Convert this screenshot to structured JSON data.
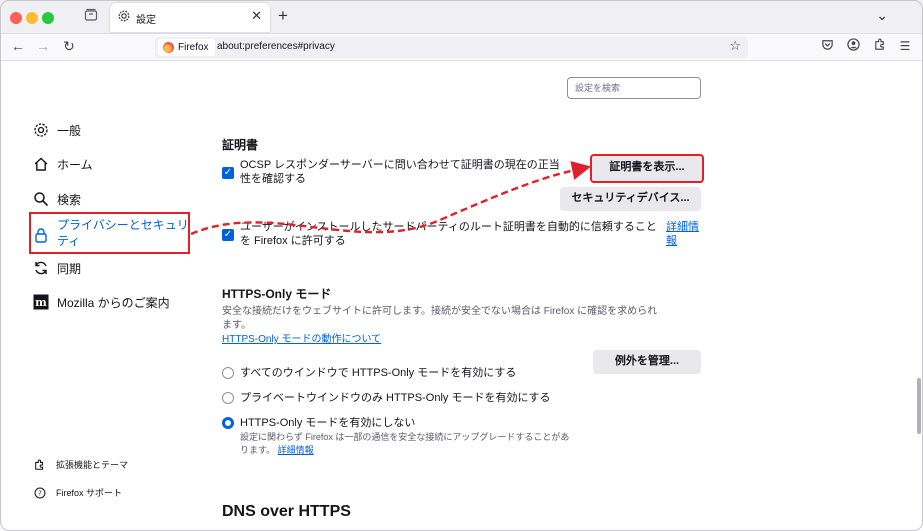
{
  "browser": {
    "tab_title": "設定",
    "identity_label": "Firefox",
    "url": "about:preferences#privacy"
  },
  "search": {
    "placeholder": "設定を検索"
  },
  "sidebar": {
    "items": [
      {
        "label": "一般",
        "icon": "gear-icon"
      },
      {
        "label": "ホーム",
        "icon": "home-icon"
      },
      {
        "label": "検索",
        "icon": "search-icon"
      },
      {
        "label_line1": "プライバシーとセキュリ",
        "label_line2": "ティ",
        "icon": "lock-icon",
        "selected": true
      },
      {
        "label": "同期",
        "icon": "sync-icon"
      },
      {
        "label": "Mozilla からのご案内",
        "icon": "mozilla-icon"
      }
    ],
    "bottom": [
      {
        "label": "拡張機能とテーマ",
        "icon": "puzzle-icon"
      },
      {
        "label": "Firefox サポート",
        "icon": "help-icon"
      }
    ]
  },
  "certificates": {
    "heading": "証明書",
    "ocsp_line1": "OCSP レスポンダーサーバーに問い合わせて証明書の現在の正当",
    "ocsp_line2": "性を確認する",
    "view_button": "証明書を表示...",
    "devices_button": "セキュリティデバイス...",
    "root_line1": "ユーザーがインストールしたサードパーティのルート証明書を自動的に信頼すること",
    "root_line2": "を Firefox に許可する",
    "learn_more_line1": "詳細情",
    "learn_more_line2": "報"
  },
  "https_only": {
    "heading": "HTTPS-Only モード",
    "desc_line1": "安全な接続だけをウェブサイトに許可します。接続が安全でない場合は Firefox に確認を求められ",
    "desc_line2": "ます。",
    "learn_link": "HTTPS-Only モードの動作について",
    "manage_button": "例外を管理...",
    "options": [
      {
        "label": "すべてのウインドウで HTTPS-Only モードを有効にする",
        "selected": false
      },
      {
        "label": "プライベートウインドウのみ HTTPS-Only モードを有効にする",
        "selected": false
      },
      {
        "label": "HTTPS-Only モードを有効にしない",
        "selected": true
      }
    ],
    "note_line1": "設定に関わらず Firefox は一部の通信を安全な接続にアップグレードすることがあ",
    "note_line2": "ります。",
    "note_link": "詳細情報"
  },
  "dns": {
    "heading": "DNS over HTTPS"
  },
  "colors": {
    "accent": "#0061e0",
    "annotation": "#e0212b"
  }
}
